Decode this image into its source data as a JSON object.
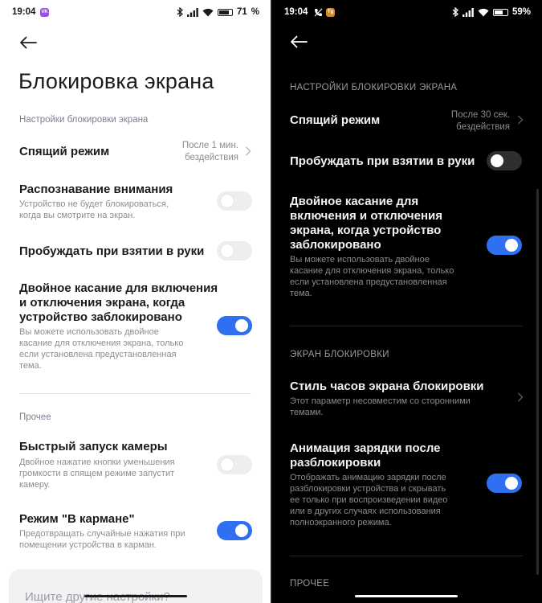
{
  "light": {
    "status": {
      "time": "19:04",
      "battery": "71",
      "battery_pct": 71,
      "badge_color": "#9b4fe8"
    },
    "title": "Блокировка экрана",
    "section_main": "Настройки блокировки экрана",
    "sleep": {
      "label": "Спящий режим",
      "value_line1": "После 1 мин.",
      "value_line2": "бездействия"
    },
    "attention": {
      "label": "Распознавание внимания",
      "desc_line1": "Устройство не будет блокироваться,",
      "desc_line2": "когда вы смотрите на экран.",
      "enabled": false
    },
    "wake": {
      "label": "Пробуждать при взятии в руки",
      "enabled": false
    },
    "double_tap": {
      "label_line1": "Двойное касание для включения",
      "label_line2": "и отключения экрана, когда",
      "label_line3": "устройство заблокировано",
      "desc_line1": "Вы можете использовать двойное",
      "desc_line2": "касание для отключения экрана, только",
      "desc_line3": "если установлена предустановленная",
      "desc_line4": "тема.",
      "enabled": true
    },
    "section_other": "Прочее",
    "camera": {
      "label": "Быстрый запуск камеры",
      "desc_line1": "Двойное нажатие кнопки уменьшения",
      "desc_line2": "громкости в спящем режиме запустит",
      "desc_line3": "камеру.",
      "enabled": false
    },
    "pocket": {
      "label": "Режим \"В кармане\"",
      "desc_line1": "Предотвращать случайные нажатия при",
      "desc_line2": "помещении устройства в карман.",
      "enabled": true
    },
    "search_placeholder": "Ищите другие настройки?"
  },
  "dark": {
    "status": {
      "time": "19:04",
      "battery": "59%",
      "battery_pct": 59
    },
    "section_main": "НАСТРОЙКИ БЛОКИРОВКИ ЭКРАНА",
    "sleep": {
      "label": "Спящий режим",
      "value_line1": "После 30 сек.",
      "value_line2": "бездействия"
    },
    "wake": {
      "label": "Пробуждать при взятии в руки",
      "enabled": false
    },
    "double_tap": {
      "label_line1": "Двойное касание для",
      "label_line2": "включения и отключения",
      "label_line3": "экрана, когда устройство",
      "label_line4": "заблокировано",
      "desc_line1": "Вы можете использовать двойное",
      "desc_line2": "касание для отключения экрана, только",
      "desc_line3": "если установлена предустановленная",
      "desc_line4": "тема.",
      "enabled": true
    },
    "section_lock": "ЭКРАН БЛОКИРОВКИ",
    "clock_style": {
      "label": "Стиль часов экрана блокировки",
      "desc_line1": "Этот параметр несовместим со сторонними",
      "desc_line2": "темами."
    },
    "charging_anim": {
      "label_line1": "Анимация зарядки после",
      "label_line2": "разблокировки",
      "desc_line1": "Отображать анимацию зарядки после",
      "desc_line2": "разблокировки устройства и скрывать",
      "desc_line3": "ее только при воспроизведении видео",
      "desc_line4": "или в других случаях использования",
      "desc_line5": "полноэкранного режима.",
      "enabled": true
    },
    "section_other": "ПРОЧЕЕ"
  },
  "colors": {
    "accent": "#2f6ff2"
  },
  "icons": [
    "back-arrow-icon",
    "bluetooth-icon",
    "signal-icon",
    "wifi-icon",
    "battery-icon",
    "chevron-right-icon",
    "app-badge-icon",
    "muted-call-icon"
  ]
}
